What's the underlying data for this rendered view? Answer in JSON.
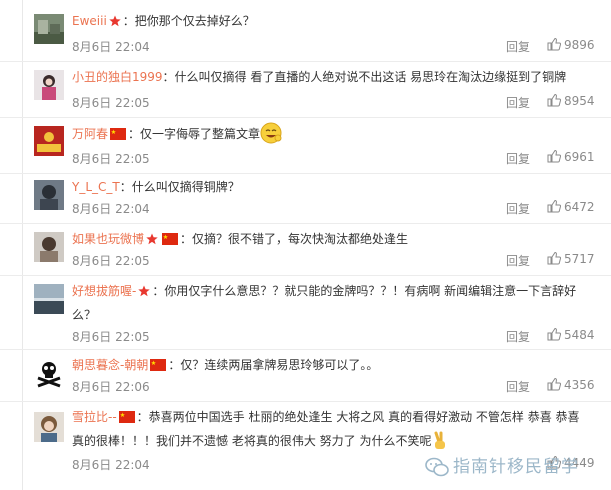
{
  "comments": [
    {
      "user": "Eweiii",
      "badges": [
        "star"
      ],
      "text": "：把你那个仅去掉好么？",
      "time": "8月6日 22:04",
      "reply": "回复",
      "likes": "9896"
    },
    {
      "user": "小丑的独白1999",
      "badges": [],
      "text": "：什么叫仅摘得 看了直播的人绝对说不出这话 易思玲在淘汰边缘挺到了铜牌",
      "time": "8月6日 22:05",
      "reply": "回复",
      "likes": "8954"
    },
    {
      "user": "万阿春",
      "badges": [
        "flag"
      ],
      "text": "：仅一字侮辱了整篇文章",
      "time": "8月6日 22:05",
      "reply": "回复",
      "likes": "6961"
    },
    {
      "user": "Y_L_C_T",
      "badges": [],
      "text": "：什么叫仅摘得铜牌？",
      "time": "8月6日 22:04",
      "reply": "回复",
      "likes": "6472"
    },
    {
      "user": "如果也玩微博",
      "badges": [
        "star",
        "flag"
      ],
      "text": "：仅摘？很不错了，每次快淘汰都绝处逢生",
      "time": "8月6日 22:05",
      "reply": "回复",
      "likes": "5717"
    },
    {
      "user": "好想拔筋喔-",
      "badges": [
        "star"
      ],
      "text": "：你用仅字什么意思？？就只能的金牌吗？？！有病啊 新闻编辑注意一下言辞好么？",
      "time": "8月6日 22:05",
      "reply": "回复",
      "likes": "5484"
    },
    {
      "user": "朝思暮念-朝朝",
      "badges": [
        "flag"
      ],
      "text": "：仅？连续两届拿牌易思玲够可以了。。",
      "time": "8月6日 22:06",
      "reply": "回复",
      "likes": "4356"
    },
    {
      "user": "雪拉比--",
      "badges": [
        "flag"
      ],
      "text": "：恭喜两位中国选手 杜丽的绝处逢生 大将之风 真的看得好激动 不管怎样 恭喜 恭喜 真的很棒！！！我们并不遗憾 老将真的很伟大 努力了 为什么不笑呢",
      "time": "8月6日 22:04",
      "reply": "回复",
      "likes": "4449"
    }
  ],
  "watermark": "指南针移民留学",
  "colors": {
    "username": "#eb7350",
    "meta": "#8a8a8a",
    "text": "#333333",
    "divider": "#ececec"
  }
}
